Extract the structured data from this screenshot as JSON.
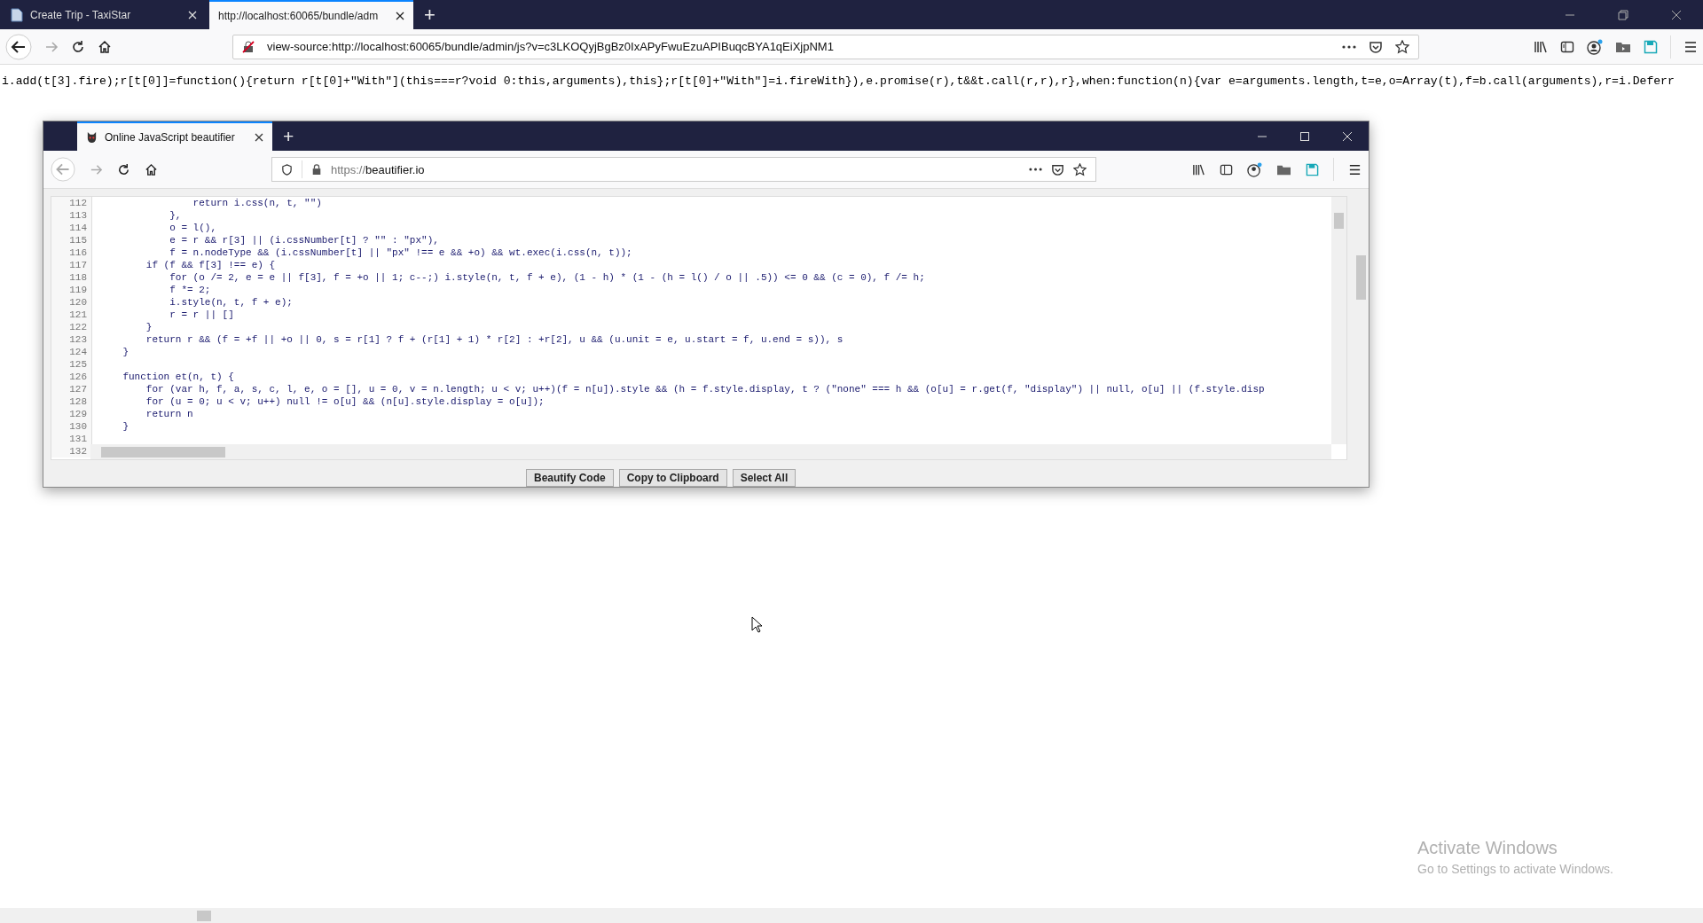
{
  "browser": {
    "tabs": [
      {
        "title": "Create Trip - TaxiStar",
        "selected": false
      },
      {
        "title": "http://localhost:60065/bundle/adm",
        "selected": true
      }
    ],
    "new_tab": "+",
    "address": "view-source:http://localhost:60065/bundle/admin/js?v=c3LKOQyjBgBz0IxAPyFwuEzuAPIBuqcBYA1qEiXjpNM1"
  },
  "source_line": "i.add(t[3].fire);r[t[0]]=function(){return r[t[0]+\"With\"](this===r?void 0:this,arguments),this};r[t[0]+\"With\"]=i.fireWith}),e.promise(r),t&&t.call(r,r),r},when:function(n){var e=arguments.length,t=e,o=Array(t),f=b.call(arguments),r=i.Deferr",
  "inner_window": {
    "tabs": [
      {
        "title": "Online JavaScript beautifier",
        "selected": true
      }
    ],
    "new_tab": "+",
    "address_scheme": "https://",
    "address_host": "beautifier.io",
    "code_lines": [
      {
        "number": "112",
        "text": "                return i.css(n, t, \"\")"
      },
      {
        "number": "113",
        "text": "            },"
      },
      {
        "number": "114",
        "text": "            o = l(),"
      },
      {
        "number": "115",
        "text": "            e = r && r[3] || (i.cssNumber[t] ? \"\" : \"px\"),"
      },
      {
        "number": "116",
        "text": "            f = n.nodeType && (i.cssNumber[t] || \"px\" !== e && +o) && wt.exec(i.css(n, t));"
      },
      {
        "number": "117",
        "text": "        if (f && f[3] !== e) {"
      },
      {
        "number": "118",
        "text": "            for (o /= 2, e = e || f[3], f = +o || 1; c--;) i.style(n, t, f + e), (1 - h) * (1 - (h = l() / o || .5)) <= 0 && (c = 0), f /= h;"
      },
      {
        "number": "119",
        "text": "            f *= 2;"
      },
      {
        "number": "120",
        "text": "            i.style(n, t, f + e);"
      },
      {
        "number": "121",
        "text": "            r = r || []"
      },
      {
        "number": "122",
        "text": "        }"
      },
      {
        "number": "123",
        "text": "        return r && (f = +f || +o || 0, s = r[1] ? f + (r[1] + 1) * r[2] : +r[2], u && (u.unit = e, u.start = f, u.end = s)), s"
      },
      {
        "number": "124",
        "text": "    }"
      },
      {
        "number": "125"
      },
      {
        "number": "126",
        "text": "    function et(n, t) {"
      },
      {
        "number": "127",
        "text": "        for (var h, f, a, s, c, l, e, o = [], u = 0, v = n.length; u < v; u++)(f = n[u]).style && (h = f.style.display, t ? (\"none\" === h && (o[u] = r.get(f, \"display\") || null, o[u] || (f.style.disp"
      },
      {
        "number": "128",
        "text": "        for (u = 0; u < v; u++) null != o[u] && (n[u].style.display = o[u]);"
      },
      {
        "number": "129",
        "text": "        return n"
      },
      {
        "number": "130",
        "text": "    }"
      },
      {
        "number": "131"
      },
      {
        "number": "132"
      }
    ],
    "buttons": [
      "Beautify Code",
      "Copy to Clipboard",
      "Select All"
    ]
  },
  "watermark_notice": {
    "title": "Activate Windows",
    "subtitle": "Go to Settings to activate Windows."
  }
}
